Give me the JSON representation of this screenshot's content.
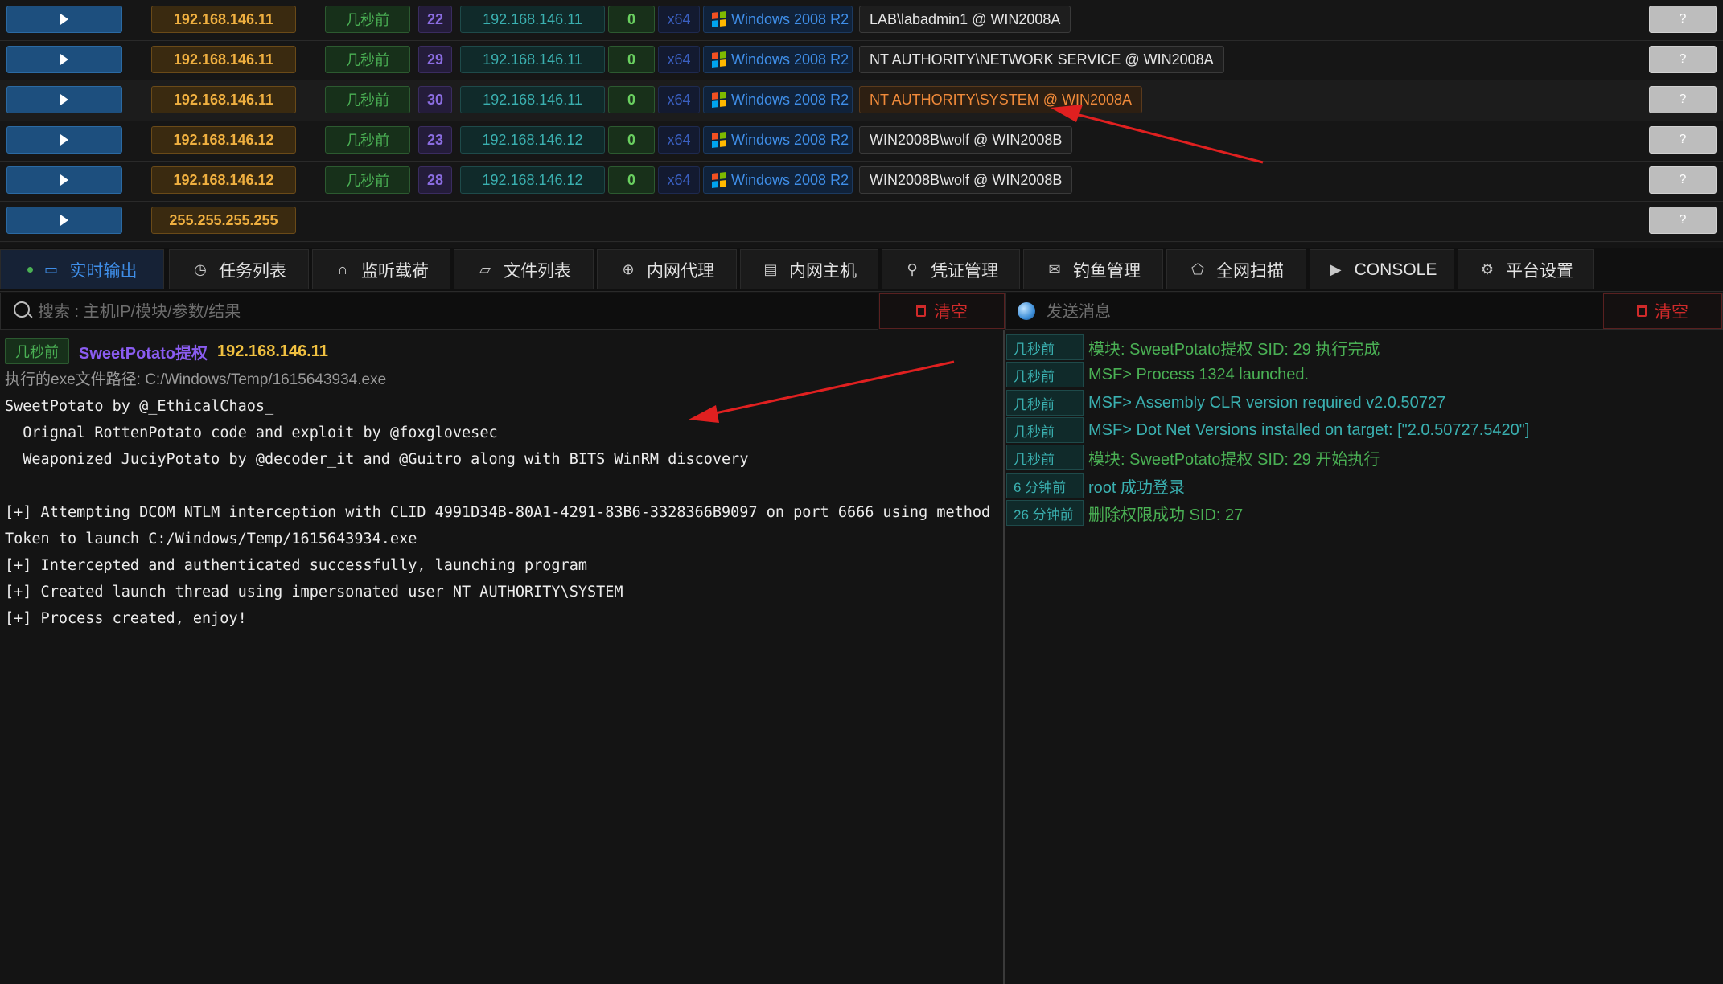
{
  "sessions": [
    {
      "ip": "192.168.146.11",
      "time": "几秒前",
      "sid": "22",
      "ip2": "192.168.146.11",
      "integrity": "0",
      "arch": "x64",
      "os": "Windows 2008 R2",
      "user": "LAB\\labadmin1 @ WIN2008A",
      "help": "?"
    },
    {
      "ip": "192.168.146.11",
      "time": "几秒前",
      "sid": "29",
      "ip2": "192.168.146.11",
      "integrity": "0",
      "arch": "x64",
      "os": "Windows 2008 R2",
      "user": "NT AUTHORITY\\NETWORK SERVICE @ WIN2008A",
      "help": "?"
    },
    {
      "ip": "192.168.146.11",
      "time": "几秒前",
      "sid": "30",
      "ip2": "192.168.146.11",
      "integrity": "0",
      "arch": "x64",
      "os": "Windows 2008 R2",
      "user": "NT AUTHORITY\\SYSTEM @ WIN2008A",
      "help": "?"
    },
    {
      "ip": "192.168.146.12",
      "time": "几秒前",
      "sid": "23",
      "ip2": "192.168.146.12",
      "integrity": "0",
      "arch": "x64",
      "os": "Windows 2008 R2",
      "user": "WIN2008B\\wolf @ WIN2008B",
      "help": "?"
    },
    {
      "ip": "192.168.146.12",
      "time": "几秒前",
      "sid": "28",
      "ip2": "192.168.146.12",
      "integrity": "0",
      "arch": "x64",
      "os": "Windows 2008 R2",
      "user": "WIN2008B\\wolf @ WIN2008B",
      "help": "?"
    },
    {
      "ip": "255.255.255.255",
      "help": "?"
    }
  ],
  "tabs": [
    {
      "label": "实时输出",
      "icon": "monitor-icon"
    },
    {
      "label": "任务列表",
      "icon": "clock-icon"
    },
    {
      "label": "监听载荷",
      "icon": "headphones-icon"
    },
    {
      "label": "文件列表",
      "icon": "folder-icon"
    },
    {
      "label": "内网代理",
      "icon": "proxy-icon"
    },
    {
      "label": "内网主机",
      "icon": "host-icon"
    },
    {
      "label": "凭证管理",
      "icon": "key-icon"
    },
    {
      "label": "钓鱼管理",
      "icon": "mail-icon"
    },
    {
      "label": "全网扫描",
      "icon": "scan-icon"
    },
    {
      "label": "CONSOLE",
      "icon": "terminal-icon"
    },
    {
      "label": "平台设置",
      "icon": "gear-icon"
    }
  ],
  "left": {
    "search_placeholder": "搜索 : 主机IP/模块/参数/结果",
    "clear_label": "清空",
    "output": {
      "time": "几秒前",
      "module": "SweetPotato提权",
      "ip": "192.168.146.11",
      "path": "执行的exe文件路径: C:/Windows/Temp/1615643934.exe",
      "console": "SweetPotato by @_EthicalChaos_\n  Orignal RottenPotato code and exploit by @foxglovesec\n  Weaponized JuciyPotato by @decoder_it and @Guitro along with BITS WinRM discovery\n\n[+] Attempting DCOM NTLM interception with CLID 4991D34B-80A1-4291-83B6-3328366B9097 on port 6666 using method Token to launch C:/Windows/Temp/1615643934.exe\n[+] Intercepted and authenticated successfully, launching program\n[+] Created launch thread using impersonated user NT AUTHORITY\\SYSTEM\n[+] Process created, enjoy!"
    }
  },
  "right": {
    "send_placeholder": "发送消息",
    "clear_label": "清空",
    "logs": [
      {
        "time": "几秒前",
        "msg": "模块: SweetPotato提权 SID: 29 执行完成",
        "style": "green"
      },
      {
        "time": "几秒前",
        "msg": "MSF> Process 1324 launched.",
        "style": "green"
      },
      {
        "time": "几秒前",
        "msg": "MSF> Assembly CLR version required v2.0.50727",
        "style": "teal"
      },
      {
        "time": "几秒前",
        "msg": "MSF> Dot Net Versions installed on target: [\"2.0.50727.5420\"]",
        "style": "teal"
      },
      {
        "time": "几秒前",
        "msg": "模块: SweetPotato提权 SID: 29 开始执行",
        "style": "green"
      },
      {
        "time": "6 分钟前",
        "msg": "root 成功登录",
        "style": "teal"
      },
      {
        "time": "26 分钟前",
        "msg": "删除权限成功 SID: 27",
        "style": "green"
      }
    ]
  },
  "colors": {
    "accent": "#3f8ee8",
    "danger": "#d02a2a",
    "arrow": "#e02020"
  }
}
